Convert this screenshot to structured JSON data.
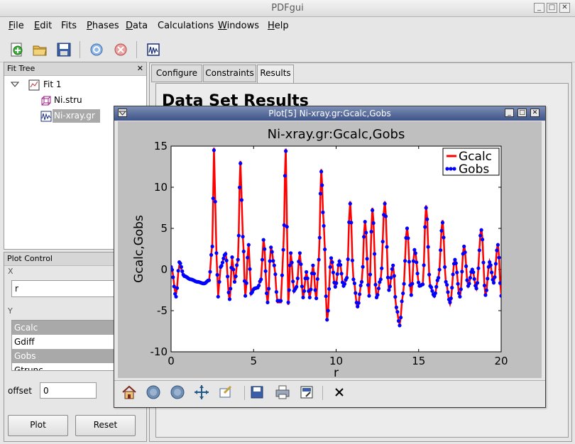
{
  "app": {
    "title": "PDFgui"
  },
  "window_buttons": {
    "minimize": "_",
    "maximize": "□",
    "close": "✕"
  },
  "menu": [
    {
      "label": "File",
      "ul": "F",
      "rest": "ile"
    },
    {
      "label": "Edit",
      "ul": "E",
      "rest": "dit"
    },
    {
      "label": "Fits",
      "ul": "",
      "rest": "Fits"
    },
    {
      "label": "Phases",
      "ul": "P",
      "rest": "hases"
    },
    {
      "label": "Data",
      "ul": "D",
      "rest": "ata"
    },
    {
      "label": "Calculations",
      "ul": "",
      "rest": "Calculations"
    },
    {
      "label": "Windows",
      "ul": "W",
      "rest": "indows"
    },
    {
      "label": "Help",
      "ul": "H",
      "rest": "elp"
    }
  ],
  "toolbar": {
    "icons": [
      "new-fit-icon",
      "open-folder-icon",
      "save-icon",
      "run-icon",
      "stop-icon",
      "quick-plot-icon"
    ]
  },
  "fit_tree": {
    "title": "Fit Tree",
    "close": "✕",
    "items": [
      {
        "label": "Fit 1"
      },
      {
        "label": "Ni.stru"
      },
      {
        "label": "Ni-xray.gr"
      }
    ]
  },
  "plot_control": {
    "title": "Plot Control",
    "x_label": "X",
    "x_value": "r",
    "y_label": "Y",
    "y_items": [
      {
        "label": "Gcalc",
        "selected": true
      },
      {
        "label": "Gdiff",
        "selected": false
      },
      {
        "label": "Gobs",
        "selected": true
      },
      {
        "label": "Gtrunc",
        "selected": false
      }
    ],
    "offset_label": "offset",
    "offset_value": "0",
    "plot_button": "Plot",
    "reset_button": "Reset"
  },
  "tabs": [
    {
      "label": "Configure",
      "active": false
    },
    {
      "label": "Constraints",
      "active": false
    },
    {
      "label": "Results",
      "active": true
    }
  ],
  "results": {
    "heading": "Data Set Results"
  },
  "plot_window": {
    "title": "Plot[5]  Ni-xray.gr:Gcalc,Gobs",
    "toolbar_icons": [
      "home-icon",
      "back-icon",
      "forward-icon",
      "pan-icon",
      "subplot-config-icon",
      "save-figure-icon",
      "print-icon",
      "export-icon",
      "close-icon"
    ]
  },
  "chart_data": {
    "type": "line",
    "title": "Ni-xray.gr:Gcalc,Gobs",
    "xlabel": "r",
    "ylabel": "Gcalc,Gobs",
    "xlim": [
      0,
      20
    ],
    "ylim": [
      -10,
      15
    ],
    "xticks": [
      0,
      5,
      10,
      15,
      20
    ],
    "yticks": [
      -10,
      -5,
      0,
      5,
      10,
      15
    ],
    "legend": "top-right",
    "grid": false,
    "series": [
      {
        "name": "Gcalc",
        "color": "#ff0000",
        "style": "line"
      },
      {
        "name": "Gobs",
        "color": "#0000ff",
        "style": "markers"
      }
    ],
    "x": [
      0.0,
      0.3,
      0.5,
      0.8,
      1.2,
      1.6,
      2.0,
      2.3,
      2.5,
      2.6,
      2.75,
      2.85,
      3.0,
      3.3,
      3.55,
      3.7,
      3.85,
      4.05,
      4.2,
      4.35,
      4.5,
      4.7,
      4.85,
      5.05,
      5.25,
      5.45,
      5.6,
      5.85,
      6.05,
      6.25,
      6.45,
      6.65,
      6.8,
      6.95,
      7.1,
      7.25,
      7.45,
      7.6,
      7.8,
      8.0,
      8.2,
      8.4,
      8.6,
      8.8,
      8.95,
      9.1,
      9.25,
      9.45,
      9.7,
      9.95,
      10.2,
      10.45,
      10.65,
      10.85,
      11.05,
      11.3,
      11.55,
      11.75,
      12.0,
      12.2,
      12.45,
      12.7,
      12.95,
      13.2,
      13.45,
      13.65,
      13.85,
      14.05,
      14.3,
      14.55,
      14.75,
      15.05,
      15.25,
      15.45,
      15.7,
      15.95,
      16.2,
      16.45,
      16.65,
      16.9,
      17.2,
      17.5,
      17.75,
      18.0,
      18.25,
      18.5,
      18.8,
      19.05,
      19.3,
      19.55,
      19.8,
      20.0
    ],
    "gcalc": [
      0.5,
      -3.0,
      0.5,
      -0.8,
      -1.2,
      -1.5,
      -1.7,
      -1.3,
      3.0,
      14.8,
      2.0,
      -3.2,
      0.3,
      2.0,
      -3.8,
      1.5,
      -1.5,
      1.2,
      13.2,
      4.0,
      -3.3,
      3.2,
      -3.0,
      -2.3,
      -2.2,
      -1.2,
      3.8,
      -4.1,
      2.8,
      0.5,
      -4.0,
      -4.0,
      2.5,
      14.7,
      -4.3,
      2.0,
      -2.7,
      -2.2,
      2.0,
      -3.5,
      -0.3,
      -3.5,
      0.5,
      -3.7,
      1.3,
      12.2,
      5.5,
      -6.3,
      1.5,
      -2.2,
      1.0,
      -2.0,
      -1.0,
      8.3,
      -1.2,
      -4.7,
      -1.5,
      6.0,
      -3.3,
      7.5,
      -3.5,
      -1.2,
      8.3,
      -2.6,
      0.5,
      -4.8,
      -6.7,
      -3.0,
      5.2,
      -3.2,
      2.5,
      -2.0,
      -1.8,
      7.8,
      -2.0,
      -3.3,
      -1.0,
      6.0,
      -1.6,
      -4.2,
      1.3,
      -3.4,
      3.0,
      -2.0,
      0.0,
      -2.3,
      5.0,
      -3.2,
      1.0,
      -1.7,
      3.2,
      -3.0
    ],
    "gobs": [
      0.3,
      -3.3,
      0.9,
      -0.8,
      -1.2,
      -1.5,
      -1.7,
      -1.3,
      2.8,
      14.5,
      2.0,
      -3.3,
      0.3,
      1.9,
      -3.6,
      1.5,
      -1.5,
      1.2,
      12.9,
      4.0,
      -3.2,
      3.0,
      -2.9,
      -2.3,
      -2.2,
      -1.2,
      3.6,
      -4.0,
      2.7,
      0.5,
      -3.8,
      -3.8,
      2.4,
      14.4,
      -4.0,
      2.0,
      -2.6,
      -2.1,
      2.0,
      -3.4,
      -0.3,
      -3.4,
      0.5,
      -3.5,
      1.2,
      11.9,
      5.3,
      -6.1,
      1.4,
      -2.1,
      1.0,
      -2.0,
      -1.0,
      8.0,
      -1.2,
      -4.5,
      -1.5,
      5.8,
      -3.2,
      7.2,
      -3.4,
      -1.2,
      8.0,
      -2.5,
      0.5,
      -4.6,
      -6.8,
      -2.9,
      5.0,
      -3.1,
      2.4,
      -2.0,
      -1.8,
      7.5,
      -2.0,
      -3.2,
      -1.0,
      5.7,
      -1.5,
      -4.0,
      1.2,
      -3.3,
      2.8,
      -2.0,
      0.0,
      -2.3,
      4.8,
      -3.1,
      0.9,
      -1.6,
      3.0,
      -3.2
    ]
  }
}
